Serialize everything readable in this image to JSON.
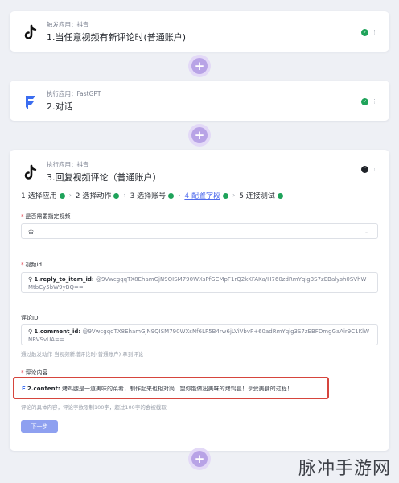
{
  "step1": {
    "app_label": "触发应用：抖音",
    "title": "1.当任意视频有新评论时(普通账户)"
  },
  "step2": {
    "app_label": "执行应用：FastGPT",
    "title": "2.对话"
  },
  "step3": {
    "app_label": "执行应用：抖音",
    "title": "3.回复视频评论（普通账户）"
  },
  "stepper": {
    "items": [
      {
        "label": "1 选择应用",
        "done": true
      },
      {
        "label": "2 选择动作",
        "done": true
      },
      {
        "label": "3 选择账号",
        "done": true
      },
      {
        "label": "4 配置字段",
        "done": true,
        "active": true
      },
      {
        "label": "5 连接测试",
        "done": true
      }
    ]
  },
  "fields": {
    "specify_video": {
      "label": "是否需要指定视频",
      "value": "否"
    },
    "video_id": {
      "label": "视频id",
      "token_key": "1.reply_to_item_id:",
      "token_value": "@9VwcgqqTX8EhamGjN9QISM790WXsPfGCMpF1rQ2kKFAKa/H760zdRmYqig3S7zEBalysh0SVhWMtbCy5bW9yBQ=="
    },
    "comment_id": {
      "label": "评论ID",
      "token_key": "1.comment_id:",
      "token_value": "@9VwcgqqTX8EhamGjN9QISM790WXsNf6LP5B4rw6jLViVbvP+60adRmYqig3S7zEBFDmgGaAir9C1KlWNRVSvUA==",
      "hint": "通过触发动作 当视频新增评论时(普通账户) 拿到评论"
    },
    "comment_content": {
      "label": "评论内容",
      "token_key": "2.content:",
      "token_value": "烤鸡腿是一道美味的菜肴，制作起来也相对简...望你能做出美味的烤鸡腿！享受美食的过程！",
      "hint": "评论的具体内容，评论字数限制100字，超过100字的会被截取"
    }
  },
  "next_label": "下一步",
  "watermark": "脉冲手游网",
  "colors": {
    "accent": "#4f6bed",
    "success": "#1fa35a",
    "highlight_border": "#d6453d",
    "add_button": "#b8a3e6"
  }
}
